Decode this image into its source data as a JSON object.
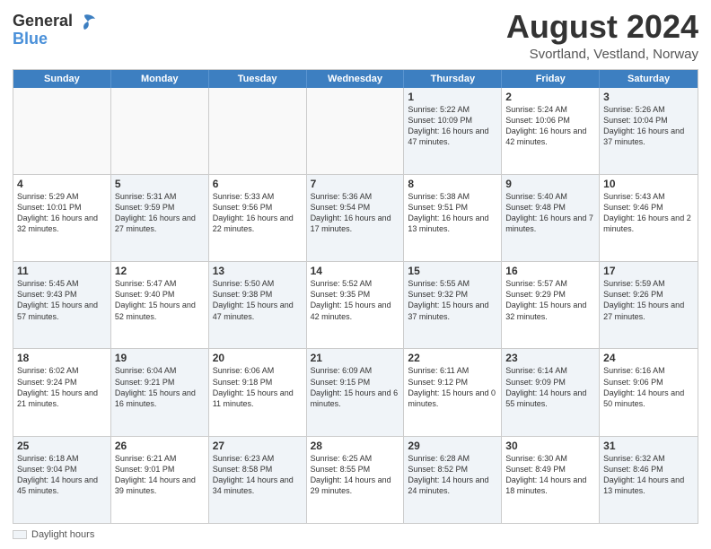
{
  "logo": {
    "general": "General",
    "blue": "Blue"
  },
  "title": {
    "month_year": "August 2024",
    "location": "Svortland, Vestland, Norway"
  },
  "weekdays": [
    "Sunday",
    "Monday",
    "Tuesday",
    "Wednesday",
    "Thursday",
    "Friday",
    "Saturday"
  ],
  "legend": {
    "label": "Daylight hours"
  },
  "weeks": [
    [
      {
        "day": "",
        "info": "",
        "shaded": false,
        "empty": true
      },
      {
        "day": "",
        "info": "",
        "shaded": false,
        "empty": true
      },
      {
        "day": "",
        "info": "",
        "shaded": false,
        "empty": true
      },
      {
        "day": "",
        "info": "",
        "shaded": false,
        "empty": true
      },
      {
        "day": "1",
        "info": "Sunrise: 5:22 AM\nSunset: 10:09 PM\nDaylight: 16 hours and 47 minutes.",
        "shaded": true,
        "empty": false
      },
      {
        "day": "2",
        "info": "Sunrise: 5:24 AM\nSunset: 10:06 PM\nDaylight: 16 hours and 42 minutes.",
        "shaded": false,
        "empty": false
      },
      {
        "day": "3",
        "info": "Sunrise: 5:26 AM\nSunset: 10:04 PM\nDaylight: 16 hours and 37 minutes.",
        "shaded": true,
        "empty": false
      }
    ],
    [
      {
        "day": "4",
        "info": "Sunrise: 5:29 AM\nSunset: 10:01 PM\nDaylight: 16 hours and 32 minutes.",
        "shaded": false,
        "empty": false
      },
      {
        "day": "5",
        "info": "Sunrise: 5:31 AM\nSunset: 9:59 PM\nDaylight: 16 hours and 27 minutes.",
        "shaded": true,
        "empty": false
      },
      {
        "day": "6",
        "info": "Sunrise: 5:33 AM\nSunset: 9:56 PM\nDaylight: 16 hours and 22 minutes.",
        "shaded": false,
        "empty": false
      },
      {
        "day": "7",
        "info": "Sunrise: 5:36 AM\nSunset: 9:54 PM\nDaylight: 16 hours and 17 minutes.",
        "shaded": true,
        "empty": false
      },
      {
        "day": "8",
        "info": "Sunrise: 5:38 AM\nSunset: 9:51 PM\nDaylight: 16 hours and 13 minutes.",
        "shaded": false,
        "empty": false
      },
      {
        "day": "9",
        "info": "Sunrise: 5:40 AM\nSunset: 9:48 PM\nDaylight: 16 hours and 7 minutes.",
        "shaded": true,
        "empty": false
      },
      {
        "day": "10",
        "info": "Sunrise: 5:43 AM\nSunset: 9:46 PM\nDaylight: 16 hours and 2 minutes.",
        "shaded": false,
        "empty": false
      }
    ],
    [
      {
        "day": "11",
        "info": "Sunrise: 5:45 AM\nSunset: 9:43 PM\nDaylight: 15 hours and 57 minutes.",
        "shaded": true,
        "empty": false
      },
      {
        "day": "12",
        "info": "Sunrise: 5:47 AM\nSunset: 9:40 PM\nDaylight: 15 hours and 52 minutes.",
        "shaded": false,
        "empty": false
      },
      {
        "day": "13",
        "info": "Sunrise: 5:50 AM\nSunset: 9:38 PM\nDaylight: 15 hours and 47 minutes.",
        "shaded": true,
        "empty": false
      },
      {
        "day": "14",
        "info": "Sunrise: 5:52 AM\nSunset: 9:35 PM\nDaylight: 15 hours and 42 minutes.",
        "shaded": false,
        "empty": false
      },
      {
        "day": "15",
        "info": "Sunrise: 5:55 AM\nSunset: 9:32 PM\nDaylight: 15 hours and 37 minutes.",
        "shaded": true,
        "empty": false
      },
      {
        "day": "16",
        "info": "Sunrise: 5:57 AM\nSunset: 9:29 PM\nDaylight: 15 hours and 32 minutes.",
        "shaded": false,
        "empty": false
      },
      {
        "day": "17",
        "info": "Sunrise: 5:59 AM\nSunset: 9:26 PM\nDaylight: 15 hours and 27 minutes.",
        "shaded": true,
        "empty": false
      }
    ],
    [
      {
        "day": "18",
        "info": "Sunrise: 6:02 AM\nSunset: 9:24 PM\nDaylight: 15 hours and 21 minutes.",
        "shaded": false,
        "empty": false
      },
      {
        "day": "19",
        "info": "Sunrise: 6:04 AM\nSunset: 9:21 PM\nDaylight: 15 hours and 16 minutes.",
        "shaded": true,
        "empty": false
      },
      {
        "day": "20",
        "info": "Sunrise: 6:06 AM\nSunset: 9:18 PM\nDaylight: 15 hours and 11 minutes.",
        "shaded": false,
        "empty": false
      },
      {
        "day": "21",
        "info": "Sunrise: 6:09 AM\nSunset: 9:15 PM\nDaylight: 15 hours and 6 minutes.",
        "shaded": true,
        "empty": false
      },
      {
        "day": "22",
        "info": "Sunrise: 6:11 AM\nSunset: 9:12 PM\nDaylight: 15 hours and 0 minutes.",
        "shaded": false,
        "empty": false
      },
      {
        "day": "23",
        "info": "Sunrise: 6:14 AM\nSunset: 9:09 PM\nDaylight: 14 hours and 55 minutes.",
        "shaded": true,
        "empty": false
      },
      {
        "day": "24",
        "info": "Sunrise: 6:16 AM\nSunset: 9:06 PM\nDaylight: 14 hours and 50 minutes.",
        "shaded": false,
        "empty": false
      }
    ],
    [
      {
        "day": "25",
        "info": "Sunrise: 6:18 AM\nSunset: 9:04 PM\nDaylight: 14 hours and 45 minutes.",
        "shaded": true,
        "empty": false
      },
      {
        "day": "26",
        "info": "Sunrise: 6:21 AM\nSunset: 9:01 PM\nDaylight: 14 hours and 39 minutes.",
        "shaded": false,
        "empty": false
      },
      {
        "day": "27",
        "info": "Sunrise: 6:23 AM\nSunset: 8:58 PM\nDaylight: 14 hours and 34 minutes.",
        "shaded": true,
        "empty": false
      },
      {
        "day": "28",
        "info": "Sunrise: 6:25 AM\nSunset: 8:55 PM\nDaylight: 14 hours and 29 minutes.",
        "shaded": false,
        "empty": false
      },
      {
        "day": "29",
        "info": "Sunrise: 6:28 AM\nSunset: 8:52 PM\nDaylight: 14 hours and 24 minutes.",
        "shaded": true,
        "empty": false
      },
      {
        "day": "30",
        "info": "Sunrise: 6:30 AM\nSunset: 8:49 PM\nDaylight: 14 hours and 18 minutes.",
        "shaded": false,
        "empty": false
      },
      {
        "day": "31",
        "info": "Sunrise: 6:32 AM\nSunset: 8:46 PM\nDaylight: 14 hours and 13 minutes.",
        "shaded": true,
        "empty": false
      }
    ]
  ]
}
